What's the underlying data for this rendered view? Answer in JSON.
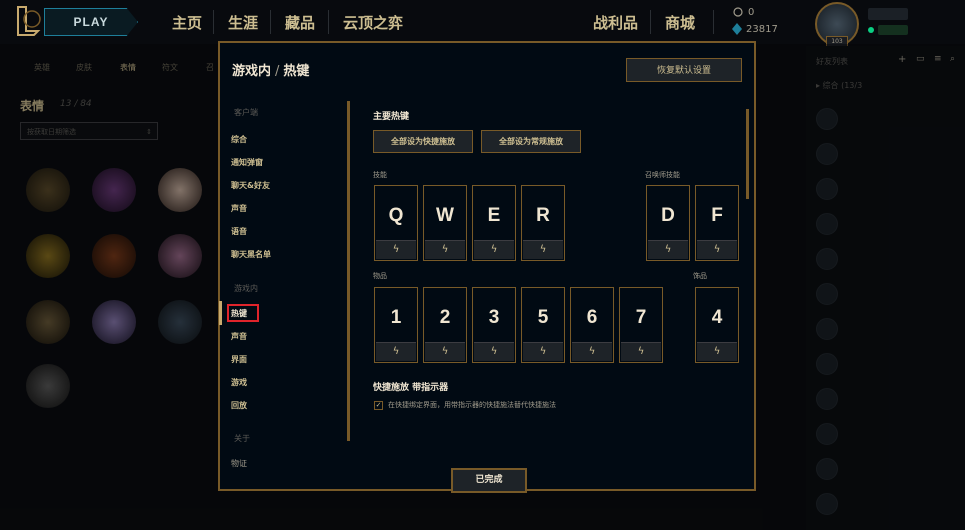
{
  "topbar": {
    "play_label": "PLAY",
    "nav": [
      "主页",
      "生涯",
      "藏品",
      "云顶之弈",
      "战利品",
      "商城"
    ],
    "currency_value": "23817",
    "profile_level": "103"
  },
  "collection": {
    "subtabs": [
      "英雄",
      "皮肤",
      "表情",
      "符文",
      "召"
    ],
    "title": "表情",
    "count": "13 / 84",
    "filter_placeholder": "按获取日期筛选"
  },
  "friends": {
    "title": "好友列表",
    "group": "▸ 综合 (13/3"
  },
  "modal": {
    "breadcrumb_parent": "游戏内",
    "breadcrumb_current": "热键",
    "restore_defaults": "恢复默认设置",
    "done": "已完成",
    "sidebar": {
      "client_label": "客户端",
      "client_items": [
        "综合",
        "通知弹窗",
        "聊天&好友",
        "声音",
        "语音",
        "聊天黑名单"
      ],
      "ingame_label": "游戏内",
      "ingame_items": [
        "热键",
        "声音",
        "界面",
        "游戏",
        "回放"
      ],
      "about_label": "关于",
      "about_items": [
        "物证"
      ]
    },
    "content": {
      "section_title": "主要热键",
      "btn_all_quick": "全部设为快捷施放",
      "btn_all_normal": "全部设为常规施放",
      "abilities_label": "技能",
      "summoner_label": "召唤师技能",
      "items_label": "物品",
      "trinket_label": "饰品",
      "ability_keys": [
        "Q",
        "W",
        "E",
        "R"
      ],
      "summoner_keys": [
        "D",
        "F"
      ],
      "item_keys": [
        "1",
        "2",
        "3",
        "5",
        "6",
        "7"
      ],
      "trinket_keys": [
        "4"
      ],
      "quickcast_title": "快捷施放 带指示器",
      "quickcast_checked": true,
      "quickcast_text": "在快捷绑定界面，用带指示器的快捷施法替代快捷施法"
    }
  },
  "colors": {
    "gold": "#785a28",
    "gold_light": "#cdbe91",
    "active_red": "#e0242b",
    "teal": "#1e7f9a"
  },
  "icons": {
    "quickcast": "lightning-bolt-icon"
  }
}
